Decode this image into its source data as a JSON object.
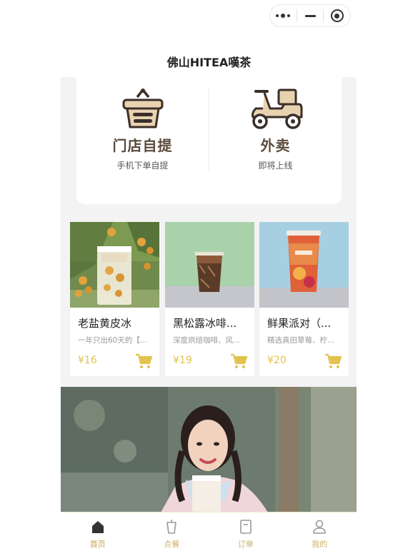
{
  "nav": {
    "title": "佛山HITEA嘆茶"
  },
  "order_options": [
    {
      "title": "门店自提",
      "subtitle": "手机下单自提",
      "icon": "basket-icon"
    },
    {
      "title": "外卖",
      "subtitle": "即将上线",
      "icon": "scooter-icon"
    }
  ],
  "products": [
    {
      "name": "老盐黄皮冰",
      "desc": "一年只出60天的【...",
      "price": "¥16"
    },
    {
      "name": "黑松露冰啡...",
      "desc": "深度烘焙咖啡、风...",
      "price": "¥19"
    },
    {
      "name": "鲜果派对（...",
      "desc": "精选真田草莓、柠...",
      "price": "¥20"
    }
  ],
  "tabbar": [
    {
      "label": "首页",
      "icon": "home-icon",
      "active": true
    },
    {
      "label": "点餐",
      "icon": "cup-icon",
      "active": false
    },
    {
      "label": "订单",
      "icon": "order-icon",
      "active": false
    },
    {
      "label": "我的",
      "icon": "user-icon",
      "active": false
    }
  ],
  "colors": {
    "accent": "#c9a34a",
    "price": "#e3c24e",
    "brown": "#5a4a3c",
    "background": "#f3f3f3"
  }
}
